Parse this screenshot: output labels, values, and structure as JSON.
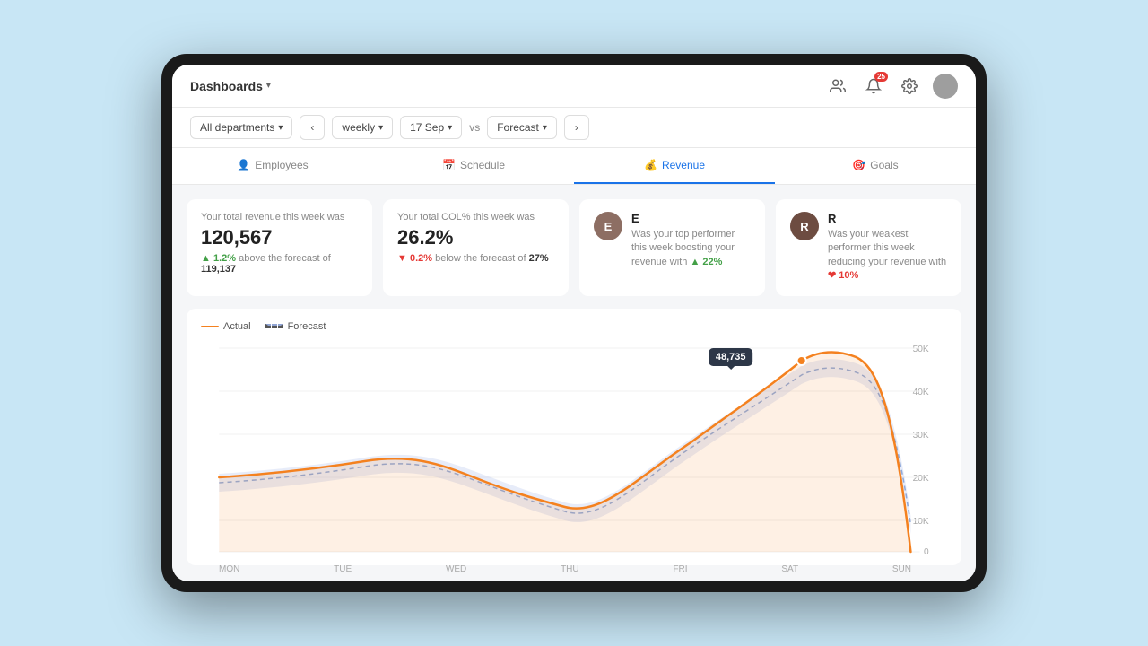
{
  "header": {
    "title": "Dashboards",
    "notif_count": "25",
    "icons": {
      "team": "👥",
      "bell": "🔔",
      "gear": "⚙️"
    }
  },
  "toolbar": {
    "department": "All departments",
    "period": "weekly",
    "date": "17 Sep",
    "vs": "vs",
    "compare": "Forecast"
  },
  "tabs": [
    {
      "label": "Employees",
      "icon": "👤",
      "id": "employees"
    },
    {
      "label": "Schedule",
      "icon": "📅",
      "id": "schedule"
    },
    {
      "label": "Revenue",
      "icon": "💰",
      "id": "revenue",
      "active": true
    },
    {
      "label": "Goals",
      "icon": "🎯",
      "id": "goals"
    }
  ],
  "cards": {
    "revenue": {
      "label": "Your total revenue this week was",
      "value": "120,567",
      "delta_pct": "1.2%",
      "delta_dir": "up",
      "forecast_label": "above the forecast of",
      "forecast_value": "119,137"
    },
    "col": {
      "label": "Your total COL% this week was",
      "value": "26.2%",
      "delta_pct": "0.2%",
      "delta_dir": "down",
      "forecast_label": "below the forecast of",
      "forecast_value": "27%"
    },
    "top_performer": {
      "initial": "E",
      "label": "Was your top performer this week boosting your revenue with",
      "value": "22%",
      "dir": "up"
    },
    "weak_performer": {
      "initial": "R",
      "label": "Was your weakest performer this week reducing your revenue with",
      "value": "10%",
      "dir": "down"
    }
  },
  "chart": {
    "legend": {
      "actual": "Actual",
      "forecast": "Forecast"
    },
    "tooltip_value": "48,735",
    "x_labels": [
      "MON",
      "TUE",
      "WED",
      "THU",
      "FRI",
      "SAT",
      "SUN"
    ],
    "y_labels": [
      "50K",
      "40K",
      "30K",
      "20K",
      "10K",
      "0"
    ]
  }
}
